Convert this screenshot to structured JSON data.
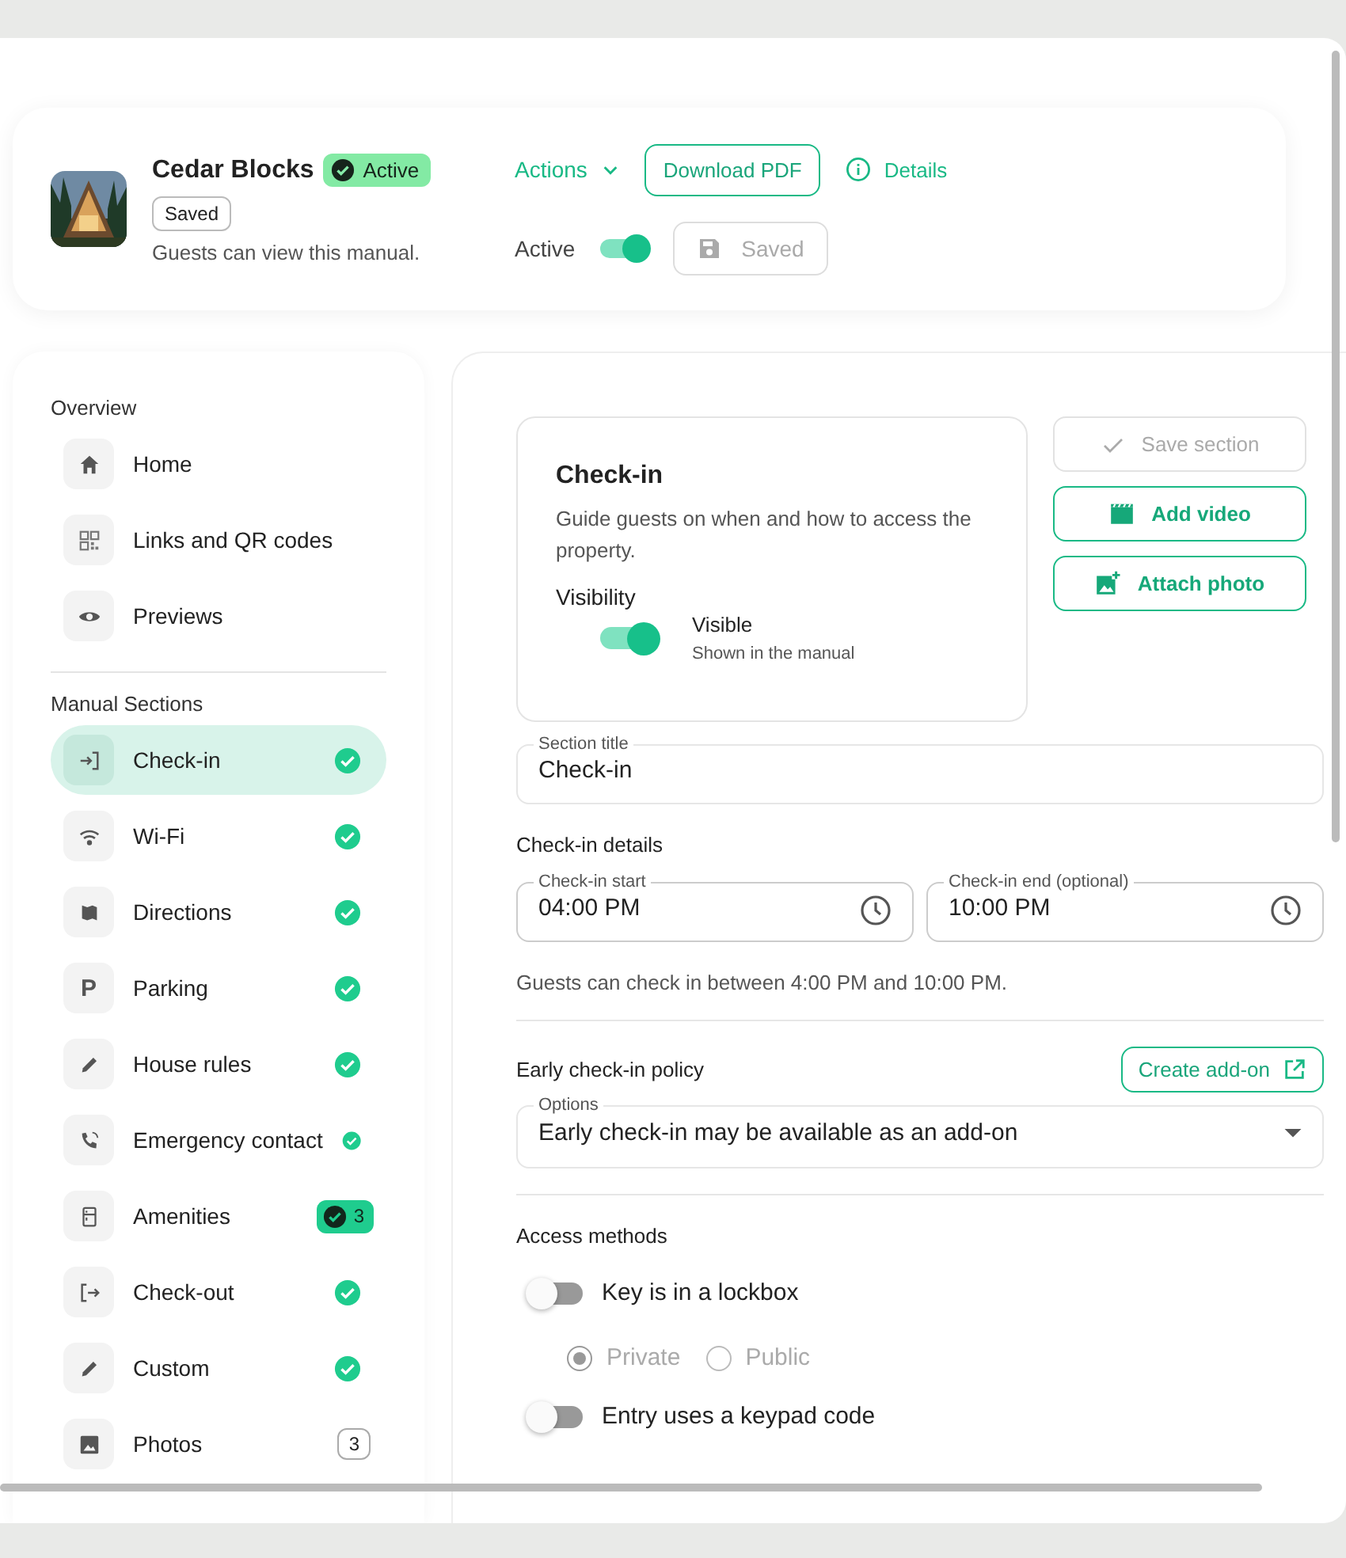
{
  "header": {
    "title": "Cedar Blocks",
    "status_badge": "Active",
    "saved_chip": "Saved",
    "caption": "Guests can view this manual.",
    "actions_menu": "Actions",
    "download_button": "Download PDF",
    "details_link": "Details",
    "active_label": "Active",
    "active_toggle": {
      "on": true
    },
    "saved_button": {
      "label": "Saved",
      "disabled": true
    }
  },
  "sidebar": {
    "groups": [
      {
        "title": "Overview",
        "items": [
          {
            "label": "Home",
            "selected": false
          },
          {
            "label": "Links and QR codes",
            "selected": false
          },
          {
            "label": "Previews",
            "selected": false
          }
        ]
      },
      {
        "title": "Manual Sections",
        "items": [
          {
            "label": "Check-in",
            "selected": true,
            "kind": "done"
          },
          {
            "label": "Wi-Fi",
            "selected": false,
            "kind": "done"
          },
          {
            "label": "Directions",
            "selected": false,
            "kind": "done"
          },
          {
            "label": "Parking",
            "selected": false,
            "kind": "done",
            "glyph": "P"
          },
          {
            "label": "House rules",
            "selected": false,
            "kind": "done"
          },
          {
            "label": "Emergency contact",
            "selected": false,
            "kind": "done"
          },
          {
            "label": "Amenities",
            "selected": false,
            "kind": "donecount",
            "count": "3"
          },
          {
            "label": "Check-out",
            "selected": false,
            "kind": "done"
          },
          {
            "label": "Custom",
            "selected": false,
            "kind": "done"
          },
          {
            "label": "Photos",
            "selected": false,
            "kind": "count",
            "count": "3"
          }
        ]
      }
    ]
  },
  "section_card": {
    "title": "Check-in",
    "description": "Guide guests on when and how to access the property.",
    "visibility_label": "Visibility",
    "visibility_toggle": {
      "on": true
    },
    "visibility_state": "Visible",
    "visibility_hint": "Shown in the manual"
  },
  "side_buttons": [
    {
      "label": "Save section",
      "disabled": true
    },
    {
      "label": "Add video",
      "disabled": false
    },
    {
      "label": "Attach photo",
      "disabled": false
    }
  ],
  "section_title_field": {
    "label": "Section title",
    "value": "Check-in"
  },
  "checkin_details": {
    "heading": "Check-in details",
    "start": {
      "label": "Check-in start",
      "value": "04:00 PM"
    },
    "end": {
      "label": "Check-in end (optional)",
      "value": "10:00 PM"
    },
    "summary": "Guests can check in between 4:00 PM and 10:00 PM."
  },
  "early_checkin": {
    "heading": "Early check-in policy",
    "create_button": "Create add-on",
    "options_label": "Options",
    "selected_option": "Early check-in may be available as an add-on"
  },
  "access_methods": {
    "heading": "Access methods",
    "methods": [
      {
        "label": "Key is in a lockbox",
        "on": false,
        "radios": [
          {
            "label": "Private",
            "selected": true,
            "disabled": true
          },
          {
            "label": "Public",
            "selected": false,
            "disabled": true
          }
        ]
      },
      {
        "label": "Entry uses a keypad code",
        "on": false
      }
    ]
  }
}
